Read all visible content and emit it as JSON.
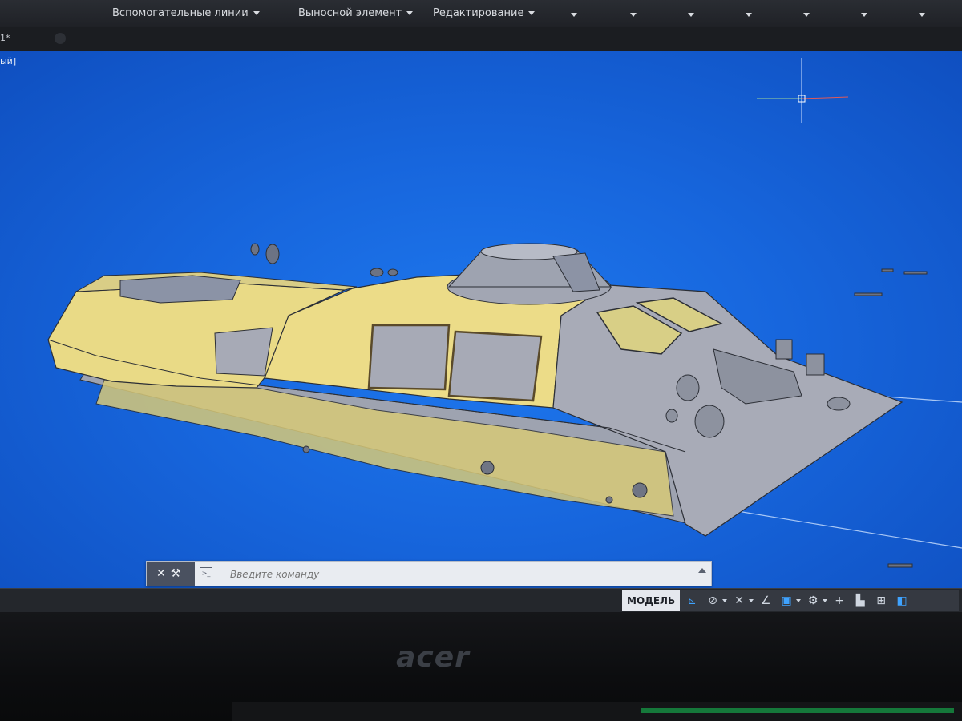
{
  "ribbon": {
    "panels": [
      {
        "label": "Вспомогательные линии"
      },
      {
        "label": "Выносной элемент"
      },
      {
        "label": "Редактирование"
      }
    ]
  },
  "drawing_tab": {
    "label": "1*"
  },
  "viewport": {
    "label": "ый]"
  },
  "command_line": {
    "placeholder": "Введите команду"
  },
  "status_bar": {
    "model_tab": "МОДЕЛЬ"
  },
  "laptop": {
    "brand": "acer"
  },
  "colors": {
    "viewport_bg": "#1766dd",
    "hull_yellow": "#e9da86",
    "hull_gray": "#a7aab6"
  },
  "icons": [
    "close-icon",
    "wrench-icon",
    "prompt-icon",
    "grid-icon",
    "snap-icon",
    "polar-icon",
    "osnap-icon",
    "ucs-icon",
    "gear-icon",
    "plus-icon",
    "workspace-icon"
  ]
}
